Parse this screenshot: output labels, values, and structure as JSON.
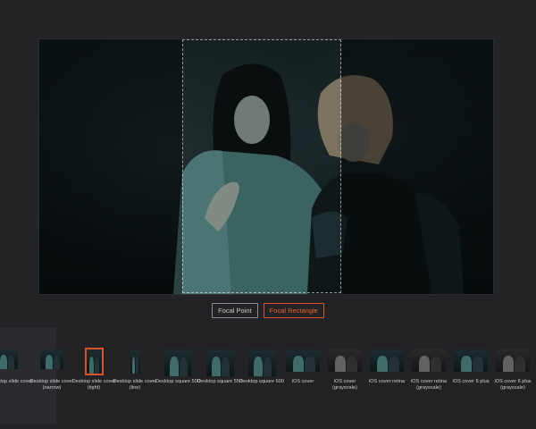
{
  "mode_buttons": {
    "focal_point": "Focal Point",
    "focal_rectangle": "Focal Rectangle"
  },
  "active_mode": "focal_rectangle",
  "accent_color": "#d8542a",
  "presets": [
    {
      "label": "Desktop slide cover"
    },
    {
      "label": "Desktop slide cover (narrow)"
    },
    {
      "label": "Desktop slide cover (tight)",
      "selected": true
    },
    {
      "label": "Desktop slide cover (line)"
    },
    {
      "label": "Desktop square 500"
    },
    {
      "label": "Desktop square 550"
    },
    {
      "label": "Desktop square 600"
    },
    {
      "label": "iOS cover"
    },
    {
      "label": "iOS cover (grayscale)",
      "grayscale": true
    },
    {
      "label": "iOS cover retina"
    },
    {
      "label": "iOS cover retina (grayscale)",
      "grayscale": true
    },
    {
      "label": "iOS cover 6 plus"
    },
    {
      "label": "iOS cover 6 plus (grayscale)",
      "grayscale": true
    }
  ]
}
